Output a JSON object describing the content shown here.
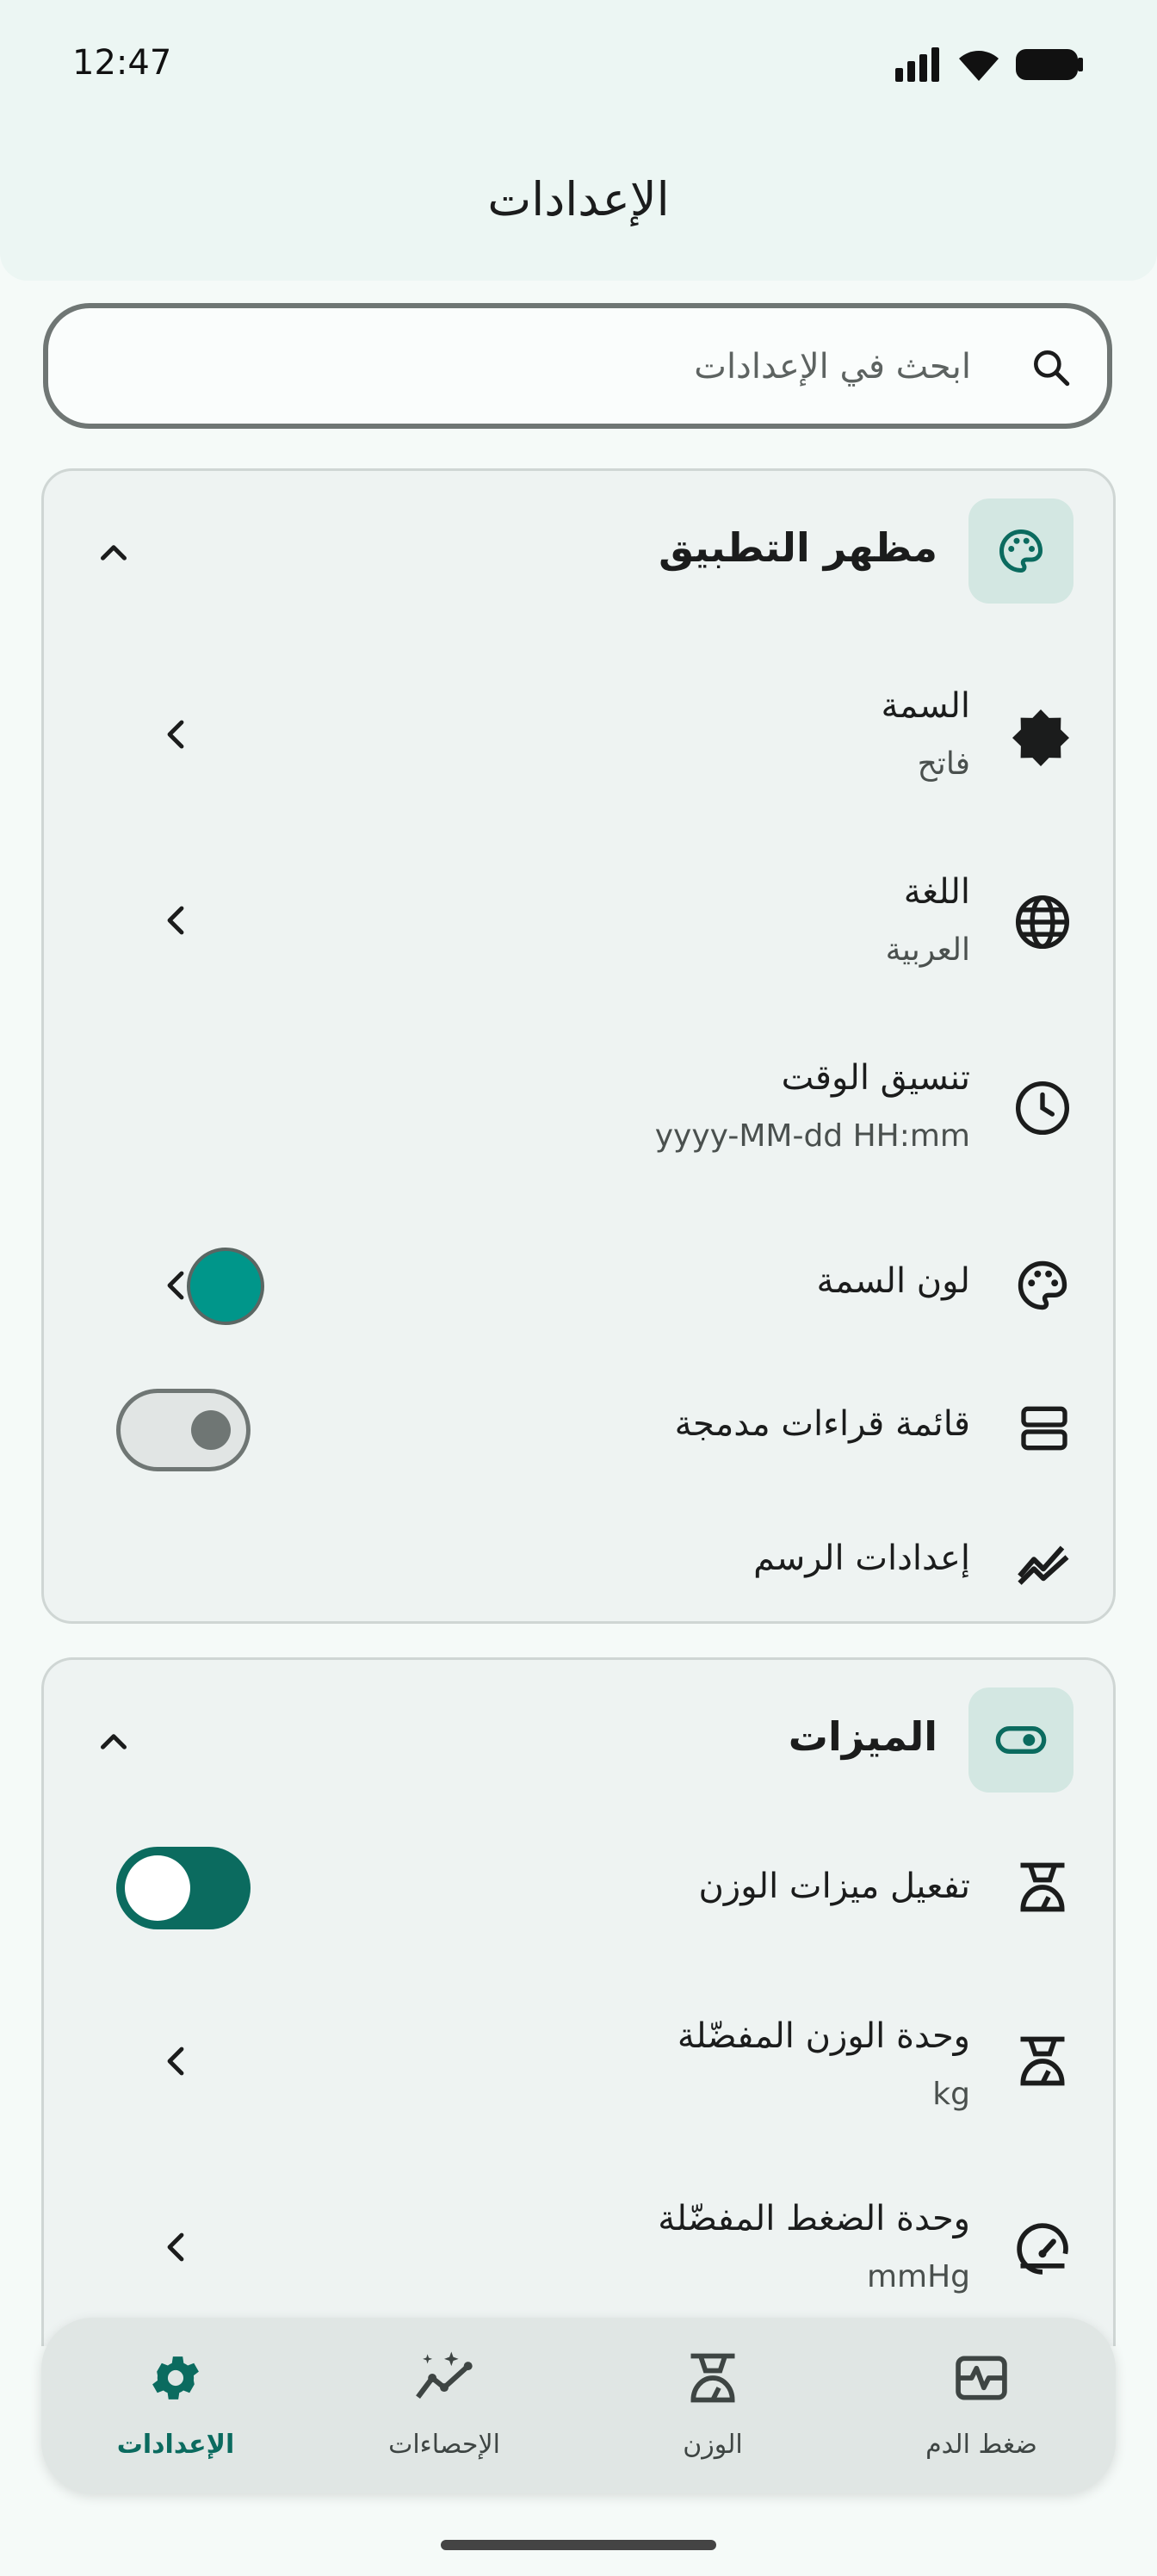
{
  "status_bar": {
    "time": "12:47"
  },
  "header": {
    "title": "الإعدادات"
  },
  "search": {
    "placeholder": "ابحث في الإعدادات"
  },
  "appearance": {
    "title": "مظهر التطبيق",
    "rows": [
      {
        "title": "السمة",
        "subtitle": "فاتح",
        "icon": "brightness-icon"
      },
      {
        "title": "اللغة",
        "subtitle": "العربية",
        "icon": "globe-icon"
      },
      {
        "title": "تنسيق الوقت",
        "subtitle": "yyyy-MM-dd HH:mm",
        "icon": "clock-icon"
      },
      {
        "title": "لون السمة",
        "icon": "palette-icon",
        "color": "#00968a"
      },
      {
        "title": "قائمة قراءات مدمجة",
        "icon": "view-agenda-icon",
        "toggle": false
      },
      {
        "title": "إعدادات الرسم",
        "icon": "chart-line-icon"
      }
    ]
  },
  "features": {
    "title": "الميزات",
    "rows": [
      {
        "title": "تفعيل ميزات الوزن",
        "icon": "scale-icon",
        "toggle": true
      },
      {
        "title": "وحدة الوزن المفضّلة",
        "subtitle": "kg",
        "icon": "scale-icon"
      },
      {
        "title": "وحدة الضغط المفضّلة",
        "subtitle": "mmHg",
        "icon": "gauge-icon"
      }
    ]
  },
  "nav": {
    "items": [
      {
        "label": "الإعدادات",
        "icon": "gear-icon",
        "active": true
      },
      {
        "label": "الإحصاءات",
        "icon": "stats-sparkle-icon",
        "active": false
      },
      {
        "label": "الوزن",
        "icon": "scale-icon",
        "active": false
      },
      {
        "label": "ضغط الدم",
        "icon": "monitor-heart-icon",
        "active": false
      }
    ]
  },
  "colors": {
    "accent": "#0b6b5f",
    "theme_color": "#00968a"
  }
}
